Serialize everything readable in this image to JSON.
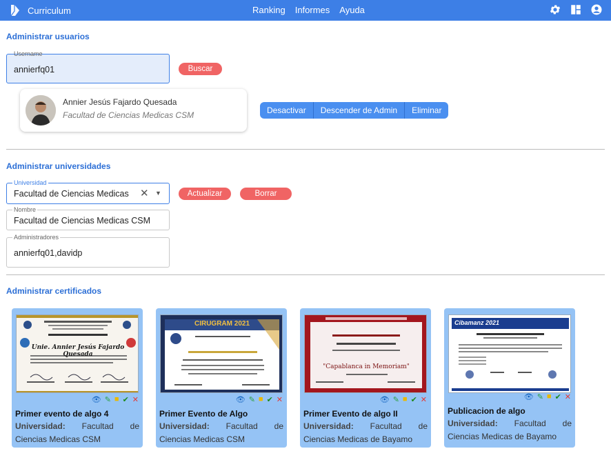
{
  "app": {
    "title": "Curriculum",
    "nav": [
      "Ranking",
      "Informes",
      "Ayuda"
    ]
  },
  "users": {
    "section_title": "Administrar usuarios",
    "username_label": "Username",
    "username_value": "annierfq01",
    "search_label": "Buscar",
    "result": {
      "name": "Annier Jesús Fajardo Quesada",
      "faculty": "Facultad de Ciencias Medicas CSM"
    },
    "actions": [
      "Desactivar",
      "Descender de Admin",
      "Eliminar"
    ]
  },
  "universities": {
    "section_title": "Administrar universidades",
    "university_label": "Universidad",
    "university_value": "Facultad de Ciencias Medicas",
    "update_label": "Actualizar",
    "delete_label": "Borrar",
    "name_label": "Nombre",
    "name_value": "Facultad de Ciencias Medicas CSM",
    "admins_label": "Administradores",
    "admins_value": "annierfq01,davidp"
  },
  "certificates": {
    "section_title": "Administrar certificados",
    "uni_prefix": "Universidad:",
    "items": [
      {
        "title": "Primer evento de algo 4",
        "university": "Facultad de Ciencias Medicas CSM"
      },
      {
        "title": "Primer Evento de Algo",
        "university": "Facultad de Ciencias Medicas CSM"
      },
      {
        "title": "Primer Evento de algo II",
        "university": "Facultad de Ciencias Medicas de Bayamo"
      },
      {
        "title": "Publicacion de algo",
        "university": "Facultad de Ciencias Medicas de Bayamo"
      }
    ],
    "thumb_text": [
      "Unie. Annier Jesús Fajardo Quesada",
      "CIRUGRAM 2021",
      "\"Capablanca in Memoriam\"",
      "Cibamanz 2021"
    ]
  },
  "colors": {
    "topbar": "#3d7fe6",
    "accent": "#2c6fd6",
    "pill": "#f06464",
    "card": "#95c3f5",
    "button": "#4a8ff0"
  }
}
